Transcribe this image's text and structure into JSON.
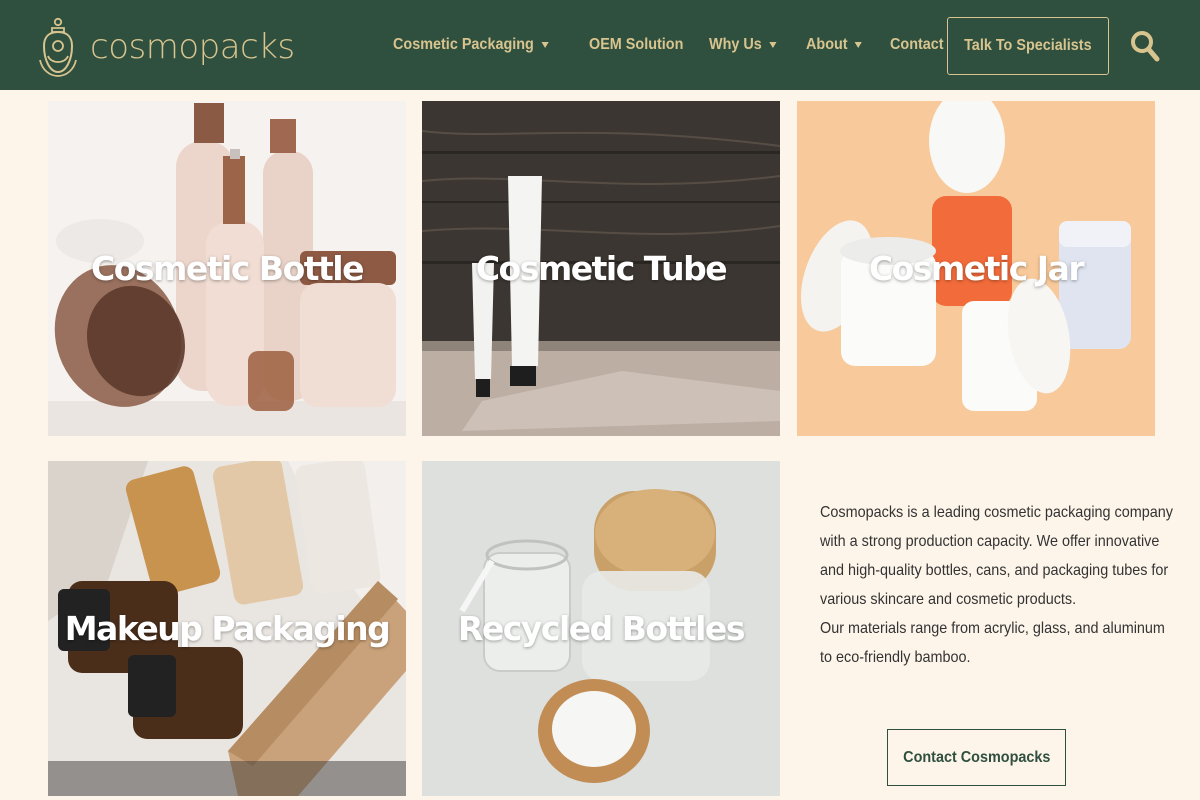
{
  "brand": {
    "name": "cosmopacks",
    "logo_icon": "bottle-face-logo"
  },
  "nav": [
    {
      "label": "Cosmetic Packaging",
      "has_dropdown": true
    },
    {
      "label": "OEM Solution",
      "has_dropdown": false
    },
    {
      "label": "Why Us",
      "has_dropdown": true
    },
    {
      "label": "About",
      "has_dropdown": true
    },
    {
      "label": "Contact",
      "has_dropdown": false
    }
  ],
  "cta": {
    "label": "Talk To Specialists"
  },
  "search": {
    "icon": "search-icon"
  },
  "tiles": [
    {
      "title": "Cosmetic Bottle"
    },
    {
      "title": "Cosmetic Tube"
    },
    {
      "title": "Cosmetic Jar"
    },
    {
      "title": "Makeup Packaging"
    },
    {
      "title": "Recycled Bottles"
    }
  ],
  "about": {
    "lines": [
      "Cosmopacks is a leading cosmetic packaging company",
      "with a strong production capacity. We offer innovative",
      "and high-quality bottles, cans, and packaging tubes for",
      "various skincare and cosmetic products.",
      "Our materials range from acrylic, glass, and aluminum",
      "to eco-friendly bamboo."
    ],
    "button_label": "Contact Cosmopacks"
  },
  "colors": {
    "header_bg": "#2f4f3f",
    "accent": "#d8c48e",
    "page_bg": "#fdf5ea"
  }
}
